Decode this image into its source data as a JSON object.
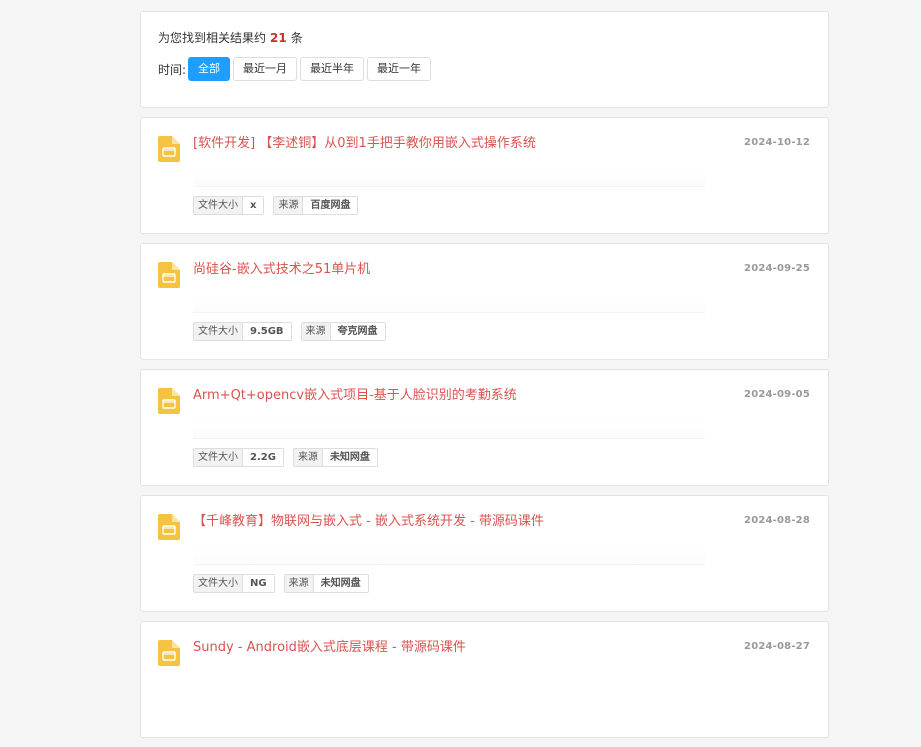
{
  "summary": {
    "prefix": "为您找到相关结果约",
    "count": "21",
    "suffix": "条",
    "time_label": "时间:",
    "filters": [
      "全部",
      "最近一月",
      "最近半年",
      "最近一年"
    ]
  },
  "labels": {
    "size": "文件大小",
    "source": "来源"
  },
  "results": [
    {
      "title": "[软件开发] 【李述铜】从0到1手把手教你用嵌入式操作系统",
      "date": "2024-10-12",
      "size": "x",
      "source": "百度网盘"
    },
    {
      "title": "尚硅谷-嵌入式技术之51单片机",
      "date": "2024-09-25",
      "size": "9.5GB",
      "source": "夸克网盘"
    },
    {
      "title": "Arm+Qt+opencv嵌入式项目-基于人脸识别的考勤系统",
      "date": "2024-09-05",
      "size": "2.2G",
      "source": "未知网盘"
    },
    {
      "title": "【千峰教育】物联网与嵌入式 - 嵌入式系统开发 - 带源码课件",
      "date": "2024-08-28",
      "size": "NG",
      "source": "未知网盘"
    },
    {
      "title": "Sundy - Android嵌入式底层课程 - 带源码课件",
      "date": "2024-08-27",
      "size": "",
      "source": ""
    }
  ],
  "colors": {
    "accent": "#1e9fff",
    "title": "#d9534f",
    "folder": "#f5c242"
  }
}
